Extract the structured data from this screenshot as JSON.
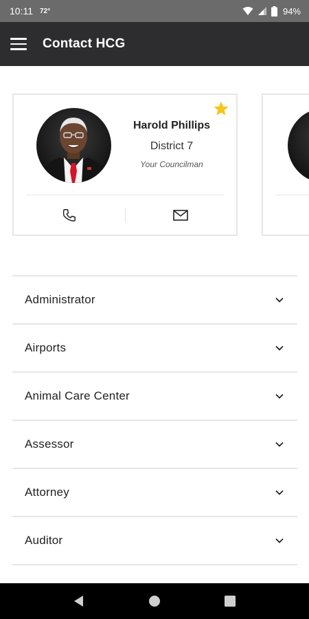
{
  "status_bar": {
    "time": "10:11",
    "temperature": "72°",
    "battery": "94%",
    "icons": [
      "wifi-icon",
      "signal-icon",
      "battery-icon"
    ]
  },
  "app_bar": {
    "title": "Contact HCG",
    "menu_icon": "hamburger-menu-icon"
  },
  "contact_cards": [
    {
      "name": "Harold Phillips",
      "district": "District 7",
      "role": "Your Councilman",
      "favorite": true,
      "star_color": "#f5c518",
      "actions": [
        "phone-icon",
        "mail-icon"
      ]
    }
  ],
  "departments": [
    {
      "label": "Administrator"
    },
    {
      "label": "Airports"
    },
    {
      "label": "Animal Care Center"
    },
    {
      "label": "Assessor"
    },
    {
      "label": "Attorney"
    },
    {
      "label": "Auditor"
    }
  ],
  "nav_bar": {
    "icons": [
      "back-icon",
      "home-icon",
      "recents-icon"
    ]
  },
  "colors": {
    "status_bar": "#6b6b6b",
    "app_bar": "#2d2d30",
    "divider": "#e5e5e5",
    "nav_bar": "#000000"
  }
}
